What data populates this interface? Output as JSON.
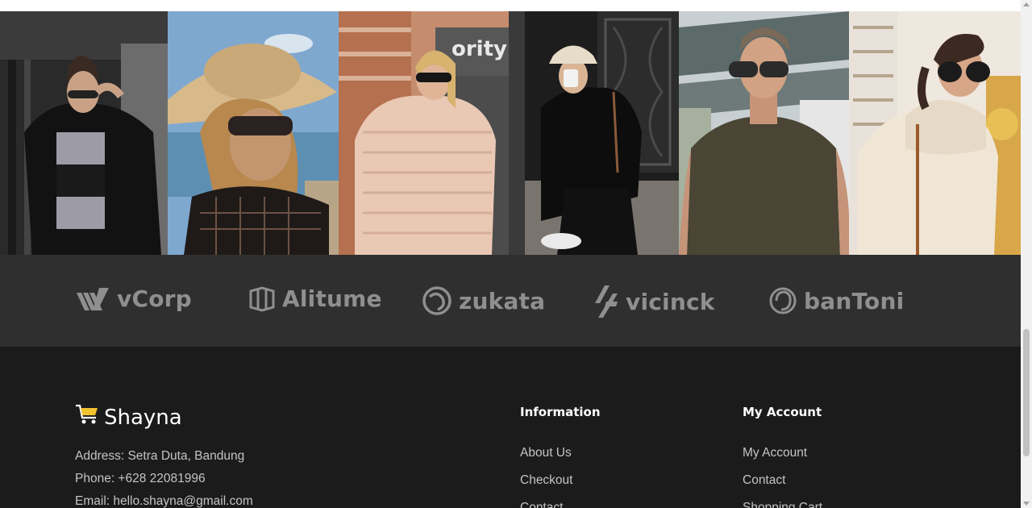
{
  "gallery": {
    "photos": [
      {
        "name": "woman-black-puffer-jacket"
      },
      {
        "name": "woman-straw-hat"
      },
      {
        "name": "woman-pink-sweater"
      },
      {
        "name": "woman-black-outfit-bucket-hat"
      },
      {
        "name": "man-sunglasses-tshirt"
      },
      {
        "name": "woman-white-turtleneck"
      }
    ]
  },
  "brands": {
    "items": [
      {
        "label": "vCorp",
        "icon": "vcorp-logo-icon"
      },
      {
        "label": "Alitume",
        "icon": "alitume-logo-icon"
      },
      {
        "label": "zukata",
        "icon": "zukata-logo-icon"
      },
      {
        "label": "vicinck",
        "icon": "vicinck-logo-icon"
      },
      {
        "label": "banToni",
        "icon": "bantoni-logo-icon"
      }
    ]
  },
  "footer": {
    "logo": {
      "text": "Shayna",
      "icon": "cart-icon",
      "accent": "#f2c230"
    },
    "address": "Address: Setra Duta, Bandung",
    "phone": "Phone: +628 22081996",
    "email": "Email: hello.shayna@gmail.com",
    "information": {
      "title": "Information",
      "links": [
        "About Us",
        "Checkout",
        "Contact"
      ]
    },
    "my_account": {
      "title": "My Account",
      "links": [
        "My Account",
        "Contact",
        "Shopping Cart"
      ]
    }
  }
}
